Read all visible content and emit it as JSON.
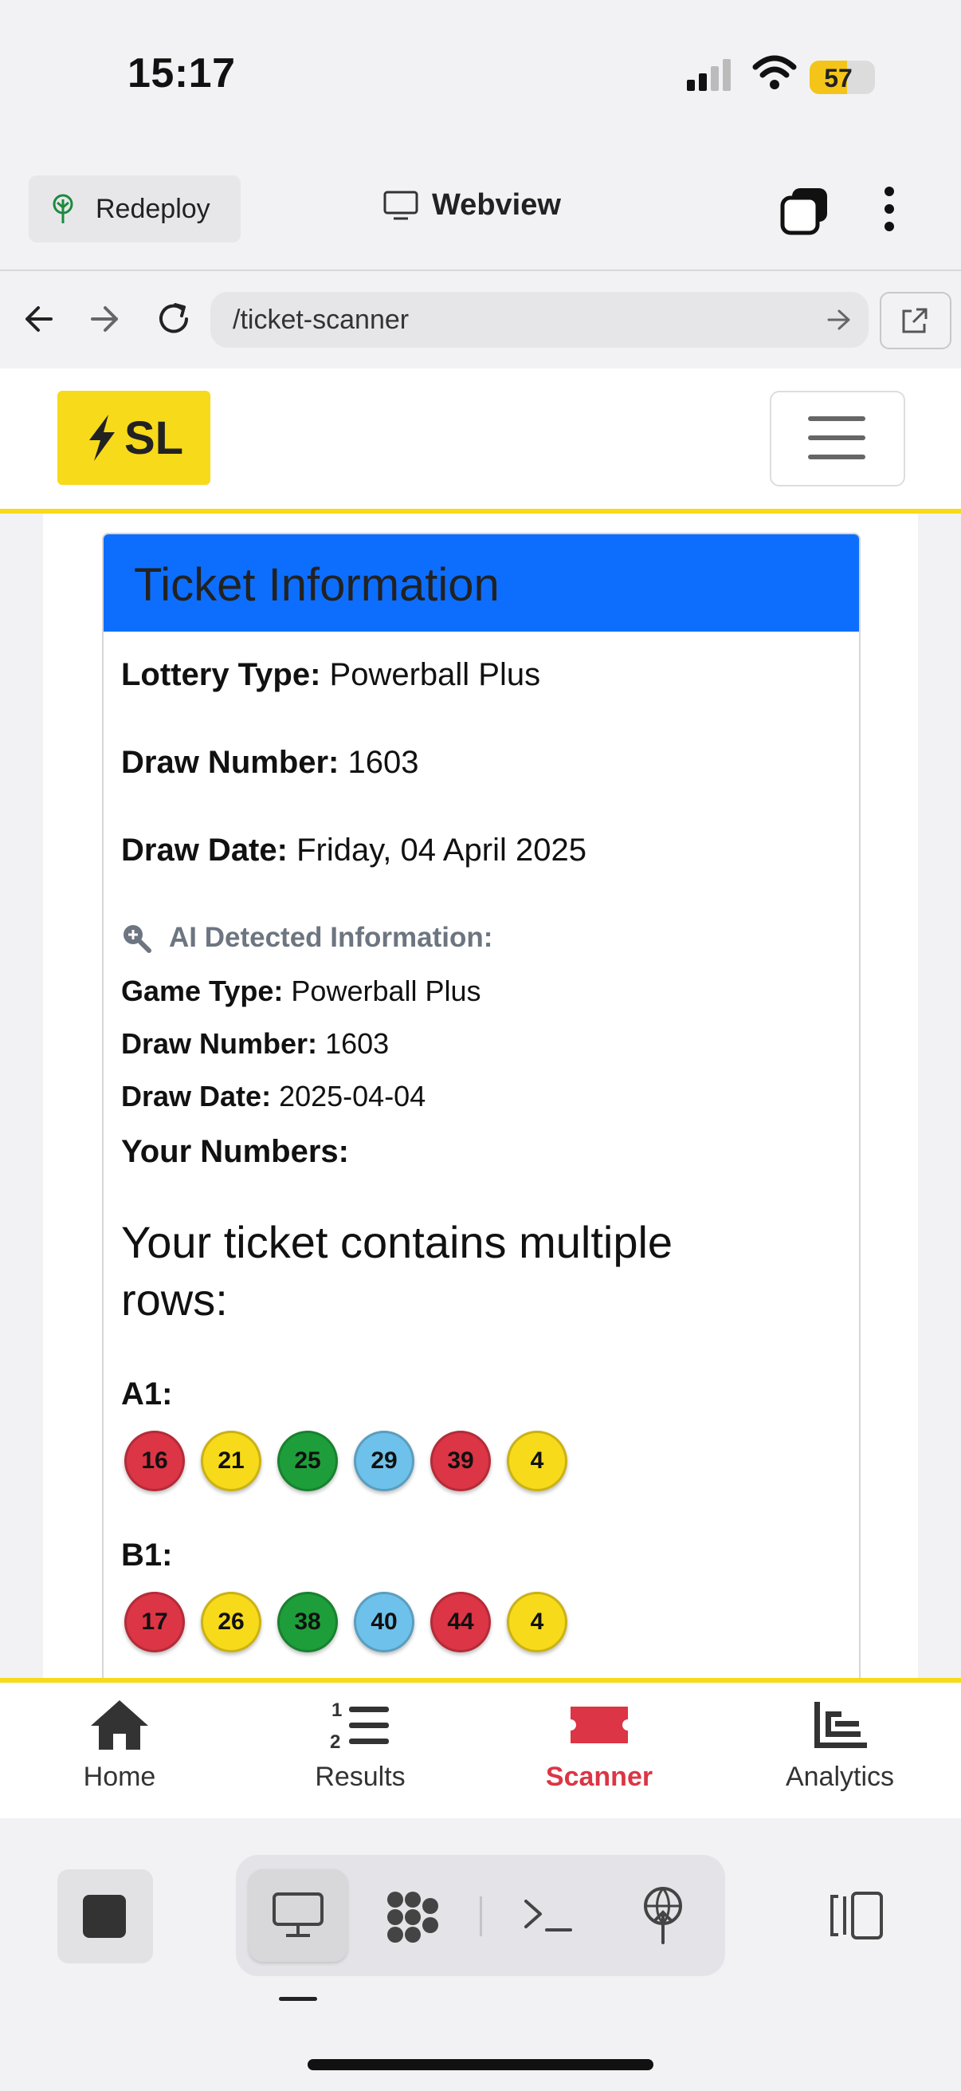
{
  "status_bar": {
    "time": "15:17",
    "battery": "57",
    "battery_level": 0.57
  },
  "app_bar": {
    "redeploy_label": "Redeploy",
    "title": "Webview"
  },
  "url_bar": {
    "url": "/ticket-scanner"
  },
  "site": {
    "logo_text": "SL"
  },
  "ticket": {
    "header": "Ticket Information",
    "lottery_type_label": "Lottery Type:",
    "lottery_type": "Powerball Plus",
    "draw_number_label": "Draw Number:",
    "draw_number": "1603",
    "draw_date_label": "Draw Date:",
    "draw_date": "Friday, 04 April 2025",
    "ai_heading": "AI Detected Information:",
    "ai_game_type_label": "Game Type:",
    "ai_game_type": "Powerball Plus",
    "ai_draw_number_label": "Draw Number:",
    "ai_draw_number": "1603",
    "ai_draw_date_label": "Draw Date:",
    "ai_draw_date": "2025-04-04",
    "your_numbers_label": "Your Numbers:",
    "multiple_rows_text": "Your ticket contains multiple rows:",
    "rows": [
      {
        "label": "A1:",
        "numbers": [
          "16",
          "21",
          "25",
          "29",
          "39",
          "4"
        ]
      },
      {
        "label": "B1:",
        "numbers": [
          "17",
          "26",
          "38",
          "40",
          "44",
          "4"
        ]
      }
    ]
  },
  "bottom_nav": {
    "items": [
      {
        "label": "Home",
        "icon": "house-icon"
      },
      {
        "label": "Results",
        "icon": "numbered-list-icon"
      },
      {
        "label": "Scanner",
        "icon": "ticket-icon",
        "active": true
      },
      {
        "label": "Analytics",
        "icon": "bar-chart-icon"
      }
    ]
  },
  "colors": {
    "accent_yellow": "#f7da1a",
    "header_blue": "#0d6efd",
    "active_red": "#dc3545"
  }
}
